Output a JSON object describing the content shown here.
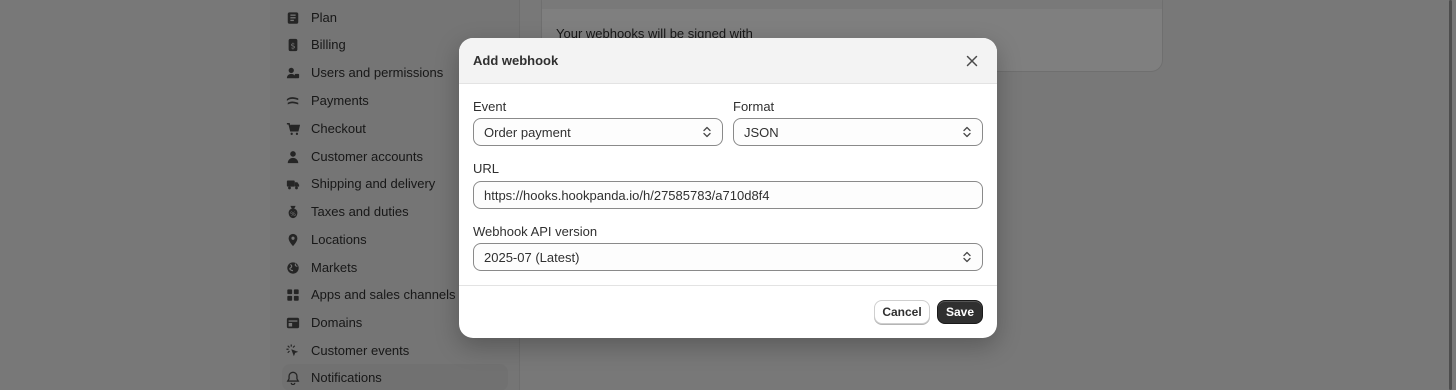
{
  "sidebar": {
    "items": [
      {
        "label": "Plan",
        "icon": "plan-icon"
      },
      {
        "label": "Billing",
        "icon": "billing-icon"
      },
      {
        "label": "Users and permissions",
        "icon": "users-icon"
      },
      {
        "label": "Payments",
        "icon": "payments-icon"
      },
      {
        "label": "Checkout",
        "icon": "cart-icon"
      },
      {
        "label": "Customer accounts",
        "icon": "person-icon"
      },
      {
        "label": "Shipping and delivery",
        "icon": "truck-icon"
      },
      {
        "label": "Taxes and duties",
        "icon": "tax-bag-icon"
      },
      {
        "label": "Locations",
        "icon": "location-pin-icon"
      },
      {
        "label": "Markets",
        "icon": "globe-icon"
      },
      {
        "label": "Apps and sales channels",
        "icon": "apps-icon"
      },
      {
        "label": "Domains",
        "icon": "domain-icon"
      },
      {
        "label": "Customer events",
        "icon": "cursor-click-icon"
      },
      {
        "label": "Notifications",
        "icon": "bell-icon"
      }
    ]
  },
  "background_card": {
    "text": "Your webhooks will be signed with"
  },
  "modal": {
    "title": "Add webhook",
    "event": {
      "label": "Event",
      "value": "Order payment"
    },
    "format": {
      "label": "Format",
      "value": "JSON"
    },
    "url": {
      "label": "URL",
      "value": "https://hooks.hookpanda.io/h/27585783/a710d8f4"
    },
    "api_version": {
      "label": "Webhook API version",
      "value": "2025-07 (Latest)"
    },
    "cancel_label": "Cancel",
    "save_label": "Save"
  },
  "colors": {
    "primary_button": "#303030",
    "overlay": "rgba(0,0,0,0.5)"
  }
}
